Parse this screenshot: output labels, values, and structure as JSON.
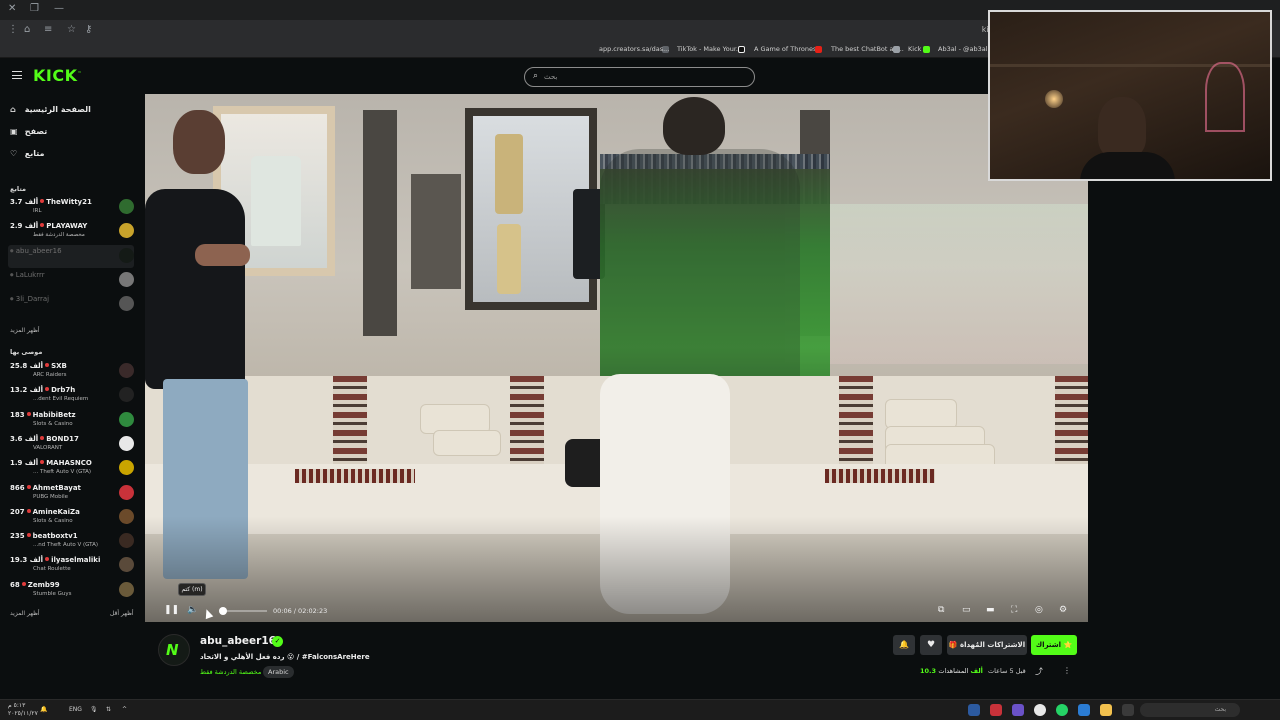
{
  "browser": {
    "url_fragment": "kic",
    "bookmarks": [
      {
        "label": "app.creators.sa/das...",
        "color": "#5f6368"
      },
      {
        "label": "TikTok - Make Your...",
        "color": "#111111"
      },
      {
        "label": "A Game of Thrones...",
        "color": "#e62117"
      },
      {
        "label": "The best ChatBot an...",
        "color": "#9aa0a6"
      },
      {
        "label": "Kick",
        "color": "#53fc18"
      },
      {
        "label": "Ab3al - @ab3al | t",
        "color": "#9aa0a6"
      }
    ]
  },
  "header": {
    "logo": "KICK",
    "search_placeholder": "بحث"
  },
  "sidebar": {
    "nav": [
      {
        "label": "الصفحة الرئيسية",
        "icon": "home-icon"
      },
      {
        "label": "تصفح",
        "icon": "browse-icon"
      },
      {
        "label": "متابع",
        "icon": "heart-icon"
      }
    ],
    "following_title": "متابع",
    "following": [
      {
        "name": "TheWitty21",
        "viewers": "3.7 ألف",
        "sub": "IRL",
        "color": "#2f6b2f",
        "live": true
      },
      {
        "name": "PLAYAWAY",
        "viewers": "2.9 ألف",
        "sub": "مخصصة الدردشة فقط",
        "color": "#c8a32b",
        "live": true
      },
      {
        "name": "abu_abeer16",
        "viewers": "",
        "sub": "",
        "color": "#141a16",
        "live": false,
        "active": true
      },
      {
        "name": "LaLukrrr",
        "viewers": "",
        "sub": "",
        "color": "#777777",
        "live": false
      },
      {
        "name": "3li_Darraj",
        "viewers": "",
        "sub": "",
        "color": "#555555",
        "live": false
      }
    ],
    "show_more_following": "أظهر المزيد",
    "recommended_title": "موصى بها",
    "recommended": [
      {
        "name": "SXB",
        "viewers": "25.8 ألف",
        "sub": "ARC Raiders",
        "color": "#3a2a2a"
      },
      {
        "name": "Drb7h",
        "viewers": "13.2 ألف",
        "sub": "...dent Evil Requiem",
        "color": "#222222"
      },
      {
        "name": "HabibiBetz",
        "viewers": "183",
        "sub": "Slots & Casino",
        "color": "#2f8a3e"
      },
      {
        "name": "BOND17",
        "viewers": "3.6 ألف",
        "sub": "VALORANT",
        "color": "#e8e8e8"
      },
      {
        "name": "MAHASNCO",
        "viewers": "1.9 ألف",
        "sub": "... Theft Auto V (GTA)",
        "color": "#c9a400"
      },
      {
        "name": "AhmetBayat",
        "viewers": "866",
        "sub": "PUBG Mobile",
        "color": "#c8323a"
      },
      {
        "name": "AmineKaiZa",
        "viewers": "207",
        "sub": "Slots & Casino",
        "color": "#6b4a2a"
      },
      {
        "name": "beatboxtv1",
        "viewers": "235",
        "sub": "...nd Theft Auto V (GTA)",
        "color": "#3a2a22"
      },
      {
        "name": "ilyaselmaliki",
        "viewers": "19.3 ألف",
        "sub": "Chat Roulette",
        "color": "#5a4a3a"
      },
      {
        "name": "Zemb99",
        "viewers": "68",
        "sub": "Stumble Guys",
        "color": "#6a5a3a"
      }
    ],
    "show_more": "أظهر المزيد",
    "show_less": "أظهر أقل"
  },
  "player": {
    "time": "00:06 / 02:02:23",
    "mute_tooltip": "كتم (m)",
    "progress": 0.0001
  },
  "stream": {
    "streamer": "abu_abeer16",
    "title": "رده فعل الأهلي و الاتحاد 😮 / #FalconsAreHere",
    "category": "مخصصة الدردشة فقط",
    "language": "Arabic",
    "subscribe": "اشتراك ⭐",
    "gift_subs": "🎁 الاشتراكات المُهداة",
    "viewers_label": "المشاهدات",
    "viewers_count": "10.3 ألف",
    "started": "قبل 5 ساعات"
  },
  "taskbar": {
    "time": "٥:١٣ م",
    "date": "٢٠٢٥/١١/٢٧",
    "lang": "ENG",
    "search_label": "بحث"
  }
}
